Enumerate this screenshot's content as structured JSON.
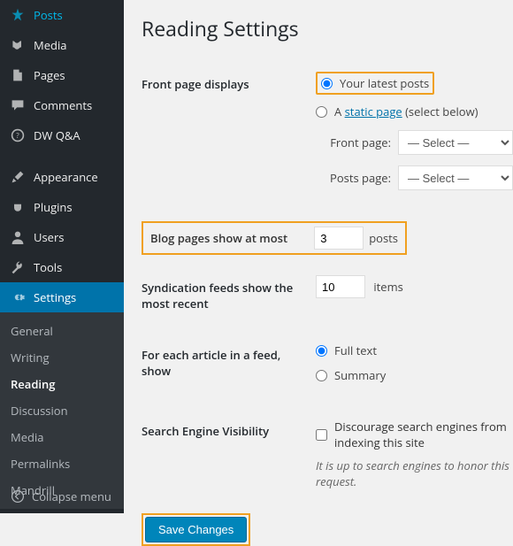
{
  "sidebar": {
    "items": [
      {
        "label": "Posts",
        "icon": "pin"
      },
      {
        "label": "Media",
        "icon": "media"
      },
      {
        "label": "Pages",
        "icon": "page"
      },
      {
        "label": "Comments",
        "icon": "comment"
      },
      {
        "label": "DW Q&A",
        "icon": "qa"
      }
    ],
    "items2": [
      {
        "label": "Appearance",
        "icon": "brush"
      },
      {
        "label": "Plugins",
        "icon": "plug"
      },
      {
        "label": "Users",
        "icon": "user"
      },
      {
        "label": "Tools",
        "icon": "tool"
      },
      {
        "label": "Settings",
        "icon": "gear"
      }
    ],
    "submenu": [
      "General",
      "Writing",
      "Reading",
      "Discussion",
      "Media",
      "Permalinks",
      "Mandrill"
    ],
    "collapse": "Collapse menu"
  },
  "page": {
    "title": "Reading Settings",
    "front_page_label": "Front page displays",
    "radio_latest": "Your latest posts",
    "radio_static_a": "A ",
    "radio_static_link": "static page",
    "radio_static_b": " (select below)",
    "front_sel_label": "Front page:",
    "posts_sel_label": "Posts page:",
    "select_placeholder": "— Select —",
    "blog_pages_label": "Blog pages show at most",
    "blog_pages_value": "3",
    "blog_pages_unit": "posts",
    "syndication_label": "Syndication feeds show the most recent",
    "syndication_value": "10",
    "syndication_unit": "items",
    "feed_label": "For each article in a feed, show",
    "feed_full": "Full text",
    "feed_summary": "Summary",
    "sev_label": "Search Engine Visibility",
    "sev_check": "Discourage search engines from indexing this site",
    "sev_desc": "It is up to search engines to honor this request.",
    "save": "Save Changes"
  }
}
